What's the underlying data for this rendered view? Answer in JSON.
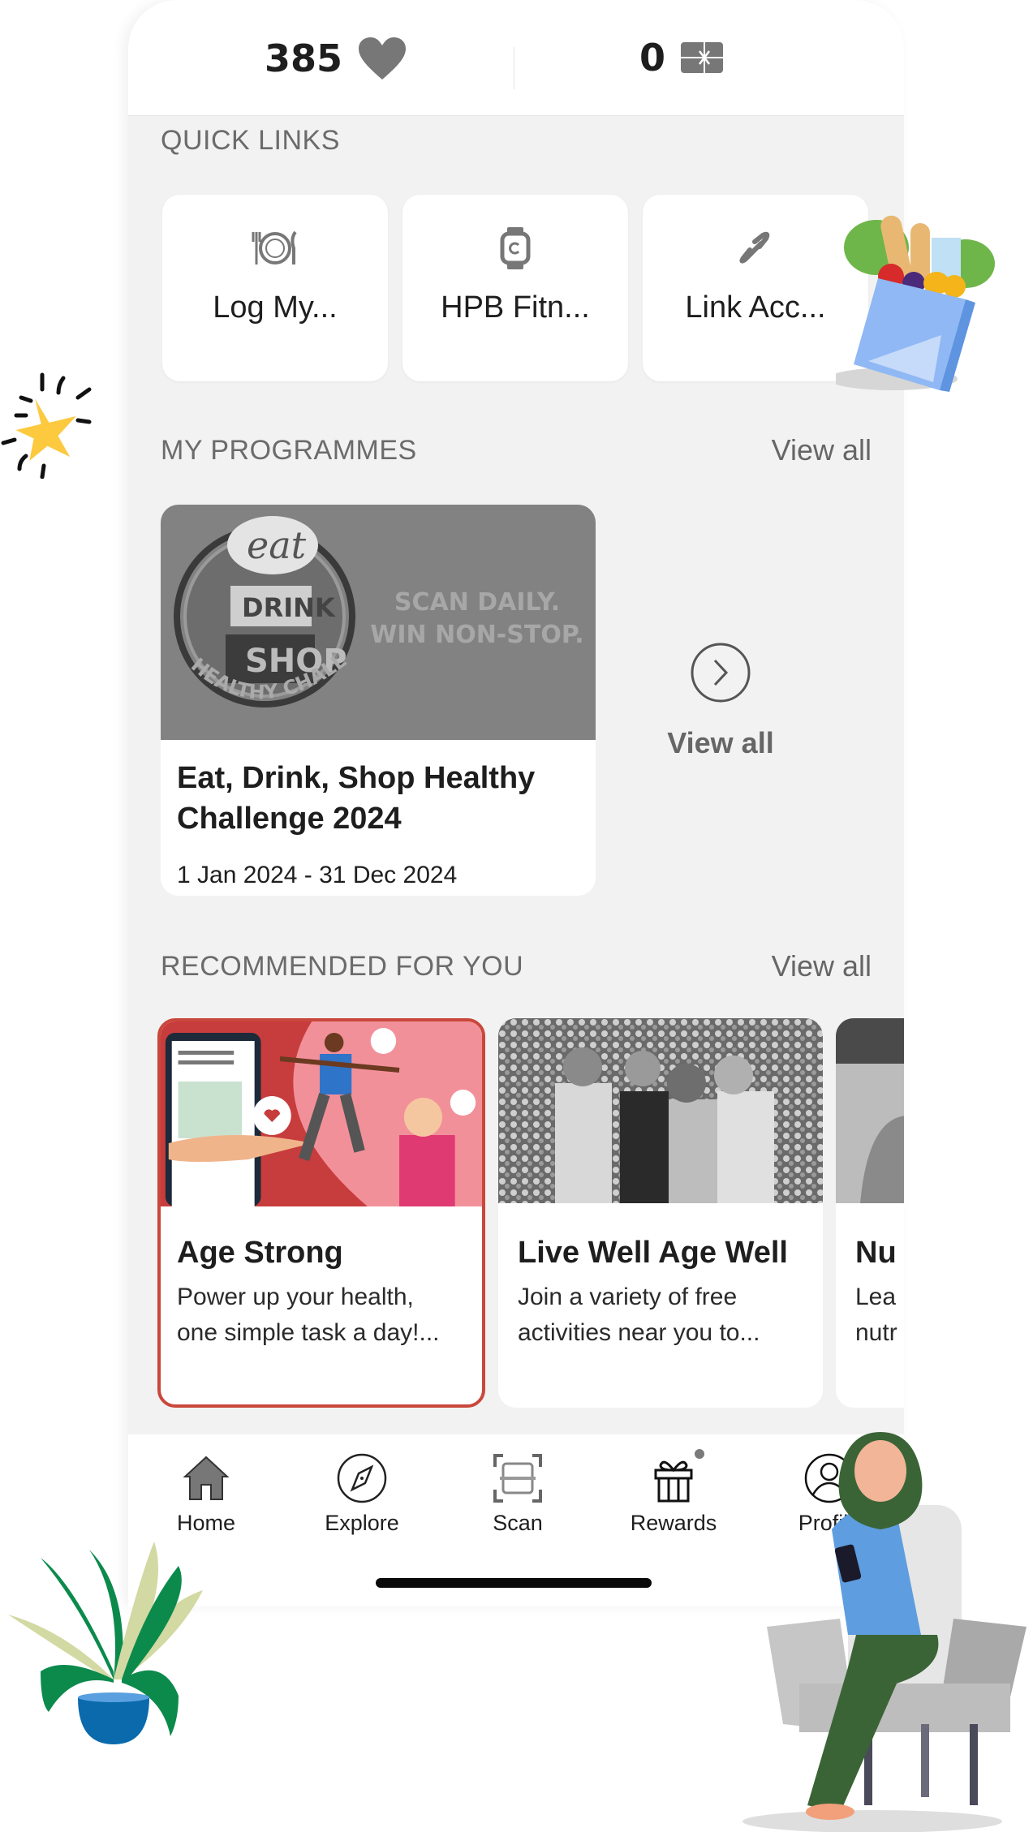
{
  "header": {
    "points": "385",
    "points_icon": "heart-icon",
    "vouchers": "0",
    "vouchers_icon": "gift-card-icon"
  },
  "quick_links": {
    "title": "QUICK LINKS",
    "items": [
      {
        "label": "Log My...",
        "icon": "plate-cutlery-icon"
      },
      {
        "label": "HPB Fitn...",
        "icon": "smartwatch-icon"
      },
      {
        "label": "Link Acc...",
        "icon": "link-icon"
      }
    ]
  },
  "programmes": {
    "title": "MY PROGRAMMES",
    "view_all": "View all",
    "items": [
      {
        "banner_tagline_1": "SCAN DAILY.",
        "banner_tagline_2": "WIN NON-STOP.",
        "banner_badge": "HEALTHY CHALLENGE",
        "title": "Eat, Drink, Shop Healthy Challenge 2024",
        "dates": "1 Jan 2024 - 31 Dec 2024"
      }
    ],
    "view_all_card": "View all"
  },
  "recommended": {
    "title": "RECOMMENDED FOR YOU",
    "view_all": "View all",
    "items": [
      {
        "title": "Age Strong",
        "desc_line1": "Power up your health,",
        "desc_line2": "one simple task a day!...",
        "selected": true
      },
      {
        "title": "Live Well Age Well",
        "desc_line1": "Join a variety of free",
        "desc_line2": "activities near you to...",
        "selected": false
      },
      {
        "title": "Nu",
        "desc_line1": "Lea",
        "desc_line2": "nutr",
        "selected": false
      }
    ]
  },
  "nav": {
    "items": [
      {
        "label": "Home",
        "icon": "home-icon",
        "badge": false
      },
      {
        "label": "Explore",
        "icon": "compass-icon",
        "badge": false
      },
      {
        "label": "Scan",
        "icon": "scan-icon",
        "badge": false
      },
      {
        "label": "Rewards",
        "icon": "gift-icon",
        "badge": true
      },
      {
        "label": "Profile",
        "icon": "profile-icon",
        "badge": true
      }
    ]
  },
  "colors": {
    "accent_red": "#c9473b",
    "background": "#f2f2f2",
    "card": "#ffffff",
    "muted_text": "#6b6b6b"
  }
}
